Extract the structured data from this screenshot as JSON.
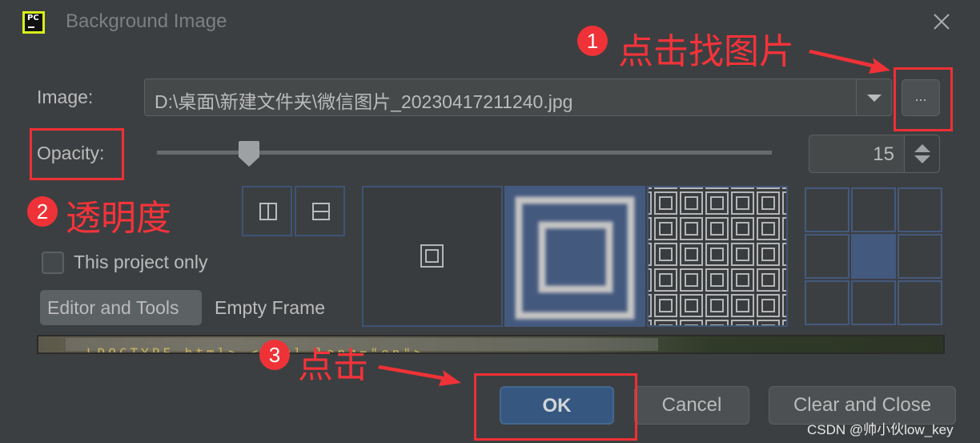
{
  "window": {
    "title": "Background Image",
    "app_icon": "pycharm-icon",
    "close_icon": "close-icon"
  },
  "image_row": {
    "label": "Image:",
    "value": "D:\\桌面\\新建文件夹\\微信图片_20230417211240.jpg",
    "dropdown_icon": "chevron-down-icon",
    "browse_label": "..."
  },
  "opacity_row": {
    "label": "Opacity:",
    "slider_percent": 15,
    "value": "15"
  },
  "flip_buttons": [
    {
      "name": "flip-horizontal",
      "icon": "split-vertical-icon"
    },
    {
      "name": "flip-vertical",
      "icon": "split-horizontal-icon"
    }
  ],
  "options": {
    "this_project_only_label": "This project only",
    "this_project_only_checked": false
  },
  "targets": {
    "active": "Editor and Tools",
    "inactive": "Empty Frame"
  },
  "fill_modes": [
    {
      "name": "center",
      "selected": false
    },
    {
      "name": "scale",
      "selected": true
    },
    {
      "name": "tile",
      "selected": false
    }
  ],
  "anchor_grid": {
    "selected_index": 4,
    "cells": 9
  },
  "buttons": {
    "ok": "OK",
    "cancel": "Cancel",
    "clear_and_close": "Clear and Close"
  },
  "preview_code": "LDOCTYPE html> <html lang=\"en\">",
  "annotations": [
    {
      "number": "1",
      "text": "点击找图片"
    },
    {
      "number": "2",
      "text": "透明度"
    },
    {
      "number": "3",
      "text": "点击"
    }
  ],
  "watermark": "CSDN @帅小伙low_key",
  "colors": {
    "background": "#3c3f41",
    "accent": "#365880",
    "selection": "#44597e",
    "annotation_red": "#ef3237"
  }
}
